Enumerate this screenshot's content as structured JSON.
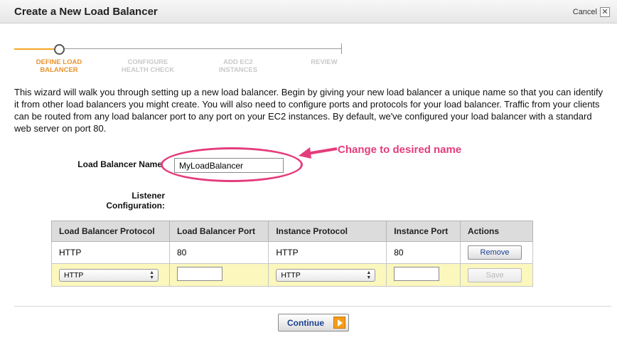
{
  "dialog": {
    "title": "Create a New Load Balancer",
    "cancel_label": "Cancel",
    "close_glyph": "✕"
  },
  "wizard": {
    "steps": [
      {
        "line1": "DEFINE LOAD",
        "line2": "BALANCER",
        "state": "active"
      },
      {
        "line1": "CONFIGURE",
        "line2": "HEALTH CHECK",
        "state": "inactive"
      },
      {
        "line1": "ADD EC2",
        "line2": "INSTANCES",
        "state": "inactive"
      },
      {
        "line1": "REVIEW",
        "line2": "",
        "state": "inactive"
      }
    ]
  },
  "intro_text": "This wizard will walk you through setting up a new load balancer. Begin by giving your new load balancer a unique name so that you can identify it from other load balancers you might create. You will also need to configure ports and protocols for your load balancer. Traffic from your clients can be routed from any load balancer port to any port on your EC2 instances. By default, we've configured your load balancer with a standard web server on port 80.",
  "form": {
    "name_label": "Load Balancer Name",
    "name_value": "MyLoadBalancer",
    "listener_label_line1": "Listener",
    "listener_label_line2": "Configuration:"
  },
  "annotation": {
    "text": "Change to desired name",
    "color": "#e43c7c"
  },
  "listeners": {
    "headers": [
      "Load Balancer Protocol",
      "Load Balancer Port",
      "Instance Protocol",
      "Instance Port",
      "Actions"
    ],
    "rows": [
      {
        "lb_protocol": "HTTP",
        "lb_port": "80",
        "instance_protocol": "HTTP",
        "instance_port": "80",
        "action": "Remove"
      }
    ],
    "new_row": {
      "lb_protocol": "HTTP",
      "instance_protocol": "HTTP",
      "action": "Save"
    }
  },
  "footer": {
    "continue_label": "Continue"
  },
  "colors": {
    "accent": "#f5a623",
    "link_blue": "#1a3f8f",
    "edit_row_bg": "#fbf7bd"
  },
  "icons": {
    "close": "close-icon",
    "continue": "play-arrow-icon",
    "select": "select-updown-icon"
  }
}
